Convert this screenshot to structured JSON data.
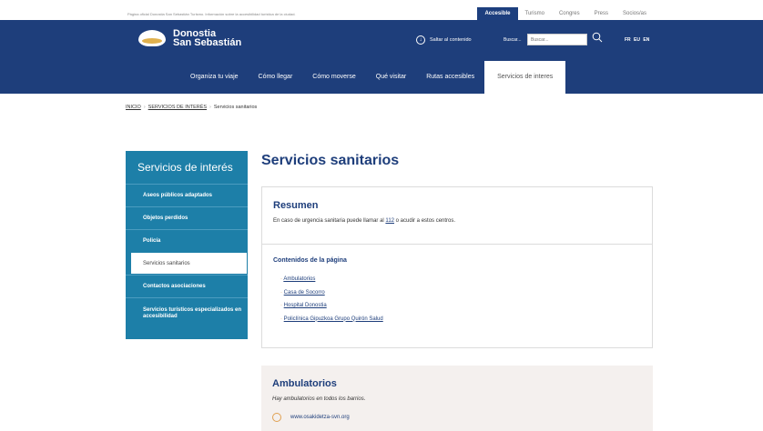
{
  "topbar": {
    "note": "Página oficial Donostia San Sebastián Turismo. Información sobre la accesibilidad turística de la ciudad.",
    "links": [
      "Accesible",
      "Turismo",
      "Congres",
      "Press",
      "Socios/as"
    ]
  },
  "header": {
    "logo_line1": "Donostia",
    "logo_line2": "San Sebastián",
    "skip": "Saltar al contenido",
    "search_label": "Buscar...",
    "search_placeholder": "Buscar...",
    "langs": "FR EU EN",
    "nav": [
      "Organiza tu viaje",
      "Cómo llegar",
      "Cómo moverse",
      "Qué visitar",
      "Rutas accesibles",
      "Servicios de interes"
    ]
  },
  "breadcrumb": {
    "home": "INICIO",
    "section": "SERVICIOS DE INTERÉS",
    "current": "Servicios sanitarios"
  },
  "sidebar": {
    "title": "Servicios de interés",
    "items": [
      "Aseos públicos adaptados",
      "Objetos perdidos",
      "Policía",
      "Servicios sanitarios",
      "Contactos asociaciones",
      "Servicios turísticos especializados en accesibilidad"
    ]
  },
  "main": {
    "title": "Servicios sanitarios",
    "resumen_title": "Resumen",
    "resumen_text_before": "En caso de urgencia sanitaria puede llamar al",
    "resumen_phone": "112",
    "resumen_text_after": "o acudir a estos centros.",
    "contents_title": "Contenidos de la página",
    "contents": [
      "Ambulatorios",
      "Casa de Socorro",
      "Hospital Donostia",
      "Policlínica Gipuzkoa Grupo Quirón Salud"
    ],
    "ambul_title": "Ambulatorios",
    "ambul_text": "Hay ambulatorios en todos los barrios.",
    "ambul_link": "www.osakidetza-svn.org"
  }
}
